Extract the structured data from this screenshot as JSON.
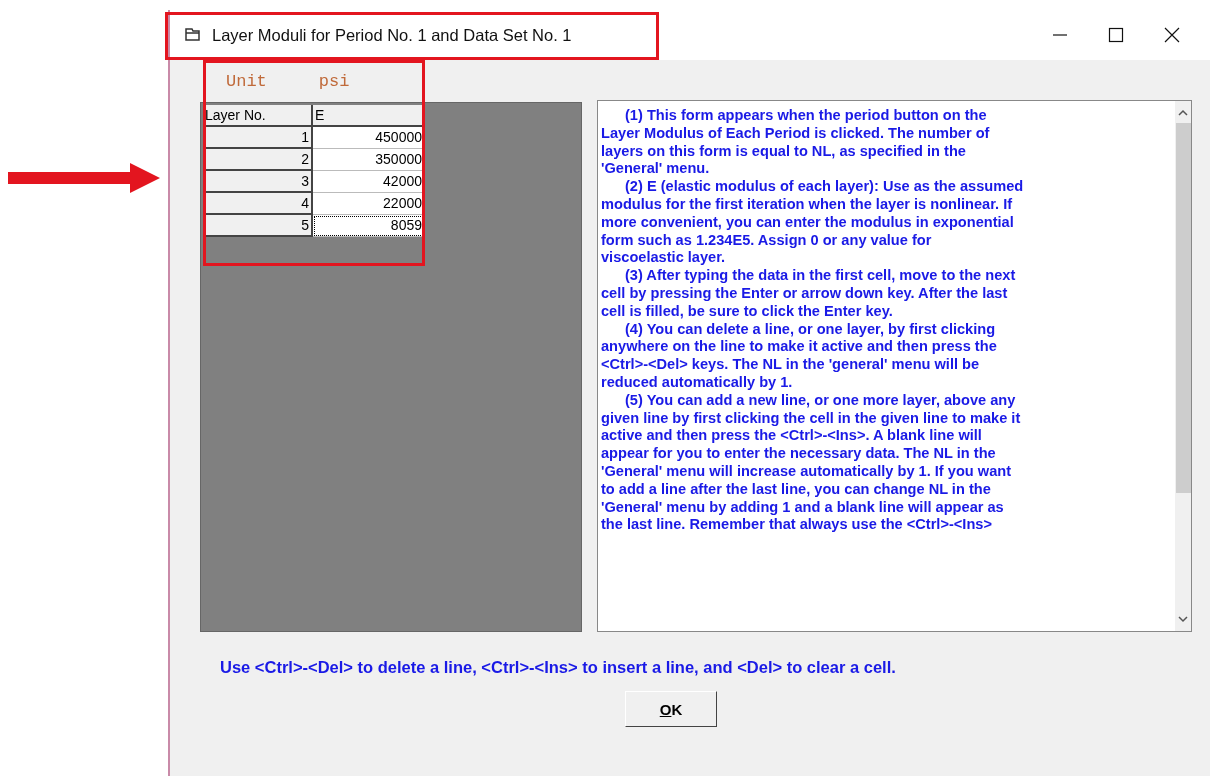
{
  "window": {
    "title": "Layer Moduli for Period No. 1 and Data Set No. 1"
  },
  "unit": {
    "label": "Unit",
    "value": "psi"
  },
  "table": {
    "columns": [
      "Layer No.",
      "E"
    ],
    "rows": [
      {
        "layer": "1",
        "e": "450000",
        "focused": false
      },
      {
        "layer": "2",
        "e": "350000",
        "focused": false
      },
      {
        "layer": "3",
        "e": "42000",
        "focused": false
      },
      {
        "layer": "4",
        "e": "22000",
        "focused": false
      },
      {
        "layer": "5",
        "e": "8059",
        "focused": true
      }
    ]
  },
  "help": [
    {
      "lines": [
        "(1)  This form appears when the period button on the",
        "Layer Modulus of Each Period is clicked.  The number of",
        "layers on this form is equal to NL, as specified in the",
        "'General' menu."
      ]
    },
    {
      "lines": [
        "(2)  E (elastic modulus of each layer): Use as the assumed",
        "modulus for the first iteration when the layer is nonlinear.  If",
        "more convenient, you can enter the modulus in exponential",
        "form such as 1.234E5.  Assign 0 or any value for",
        "viscoelastic layer."
      ]
    },
    {
      "lines": [
        "(3)  After typing the data in the first cell, move to the next",
        "cell by pressing the Enter or arrow down key.  After the last",
        "cell is filled, be sure to click the Enter key."
      ]
    },
    {
      "lines": [
        "(4)  You can delete a line, or one layer, by first clicking",
        "anywhere on the line to make it active and then press the",
        "<Ctrl>-<Del> keys.  The NL in the 'general' menu will be",
        "reduced automatically by 1."
      ]
    },
    {
      "lines": [
        "(5) You can add a new line, or one more layer, above any",
        "given line by first clicking the cell in the given line to make it",
        "active and then press the <Ctrl>-<Ins>.  A blank line will",
        "appear for you to enter the necessary data.  The NL in the",
        "'General' menu will increase automatically by 1.  If you want",
        "to add a line after the last line, you can change NL in the",
        "'General' menu by adding 1 and a blank line will appear as",
        "the last line.  Remember that always use the <Ctrl>-<Ins>"
      ]
    }
  ],
  "note": "Use <Ctrl>-<Del> to delete a line, <Ctrl>-<Ins> to insert a line, and <Del> to clear a cell.",
  "ok_button": "OK"
}
